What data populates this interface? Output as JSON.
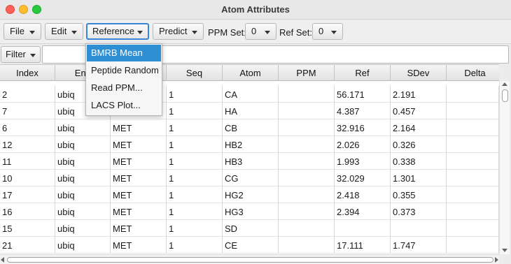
{
  "window": {
    "title": "Atom Attributes"
  },
  "toolbar": {
    "file": "File",
    "edit": "Edit",
    "reference": "Reference",
    "predict": "Predict",
    "ppm_set_label": "PPM Set:",
    "ppm_set_value": "0",
    "ref_set_label": "Ref Set:",
    "ref_set_value": "0"
  },
  "filter": {
    "label": "Filter",
    "value": ""
  },
  "reference_menu": {
    "items": [
      "BMRB Mean",
      "Peptide Random",
      "Read PPM...",
      "LACS Plot..."
    ],
    "selected": "BMRB Mean"
  },
  "table": {
    "columns": [
      "Index",
      "Enti",
      "",
      "Seq",
      "Atom",
      "PPM",
      "Ref",
      "SDev",
      "Delta"
    ],
    "rows": [
      [
        "2",
        "ubiq",
        "",
        "1",
        "CA",
        "",
        "56.171",
        "2.191",
        ""
      ],
      [
        "7",
        "ubiq",
        "",
        "1",
        "HA",
        "",
        "4.387",
        "0.457",
        ""
      ],
      [
        "6",
        "ubiq",
        "MET",
        "1",
        "CB",
        "",
        "32.916",
        "2.164",
        ""
      ],
      [
        "12",
        "ubiq",
        "MET",
        "1",
        "HB2",
        "",
        "2.026",
        "0.326",
        ""
      ],
      [
        "11",
        "ubiq",
        "MET",
        "1",
        "HB3",
        "",
        "1.993",
        "0.338",
        ""
      ],
      [
        "10",
        "ubiq",
        "MET",
        "1",
        "CG",
        "",
        "32.029",
        "1.301",
        ""
      ],
      [
        "17",
        "ubiq",
        "MET",
        "1",
        "HG2",
        "",
        "2.418",
        "0.355",
        ""
      ],
      [
        "16",
        "ubiq",
        "MET",
        "1",
        "HG3",
        "",
        "2.394",
        "0.373",
        ""
      ],
      [
        "15",
        "ubiq",
        "MET",
        "1",
        "SD",
        "",
        "",
        "",
        ""
      ],
      [
        "21",
        "ubiq",
        "MET",
        "1",
        "CE",
        "",
        "17.111",
        "1.747",
        ""
      ]
    ]
  },
  "colors": {
    "accent": "#2f8fd4",
    "focus": "#3a86d6"
  }
}
